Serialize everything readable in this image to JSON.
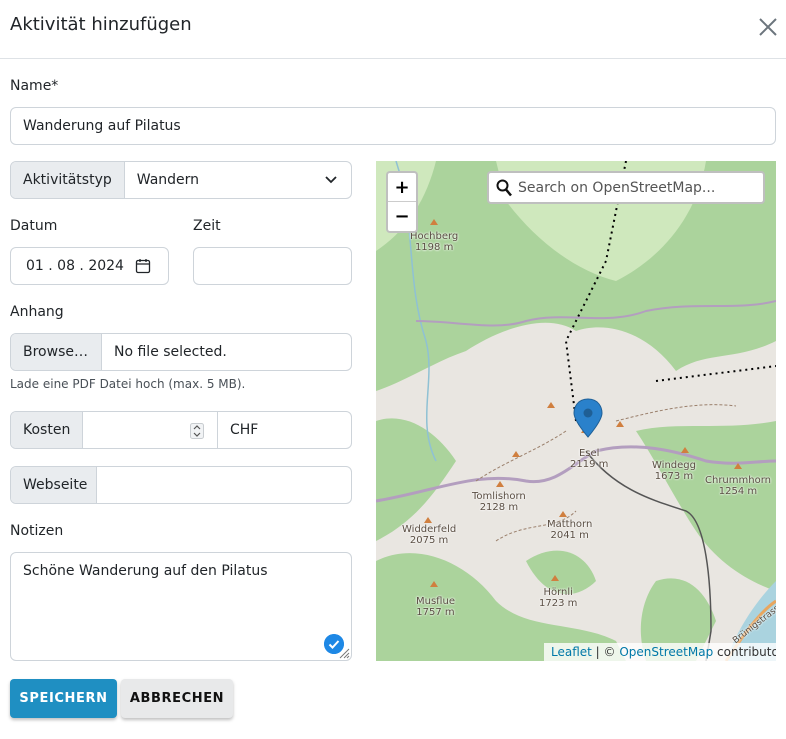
{
  "modal": {
    "title": "Aktivität hinzufügen"
  },
  "form": {
    "name_label": "Name*",
    "name_value": "Wanderung auf Pilatus",
    "type_label": "Aktivitätstyp",
    "type_value": "Wandern",
    "date_label": "Datum",
    "date_value": "01 . 08 . 2024",
    "time_label": "Zeit",
    "time_value": "",
    "attachment_label": "Anhang",
    "browse_label": "Browse…",
    "file_status": "No file selected.",
    "attachment_hint": "Lade eine PDF Datei hoch (max. 5 MB).",
    "cost_label": "Kosten",
    "cost_value": "",
    "currency_value": "CHF",
    "website_label": "Webseite",
    "website_value": "",
    "notes_label": "Notizen",
    "notes_value": "Schöne Wanderung auf den Pilatus"
  },
  "buttons": {
    "save": "SPEICHERN",
    "cancel": "ABBRECHEN"
  },
  "map": {
    "zoom_in": "+",
    "zoom_out": "−",
    "search_placeholder": "Search on OpenStreetMap...",
    "attribution": {
      "leaflet": "Leaflet",
      "separator": " | © ",
      "osm": "OpenStreetMap",
      "suffix": " contributors"
    },
    "places": [
      {
        "name": "Hochberg",
        "elev": "1198 m"
      },
      {
        "name": "Esel",
        "elev": "2119 m"
      },
      {
        "name": "Windegg",
        "elev": "1673 m"
      },
      {
        "name": "Chrummhorn",
        "elev": "1254 m"
      },
      {
        "name": "Tomlishorn",
        "elev": "2128 m"
      },
      {
        "name": "Widderfeld",
        "elev": "2075 m"
      },
      {
        "name": "Matthorn",
        "elev": "2041 m"
      },
      {
        "name": "Hörnli",
        "elev": "1723 m"
      },
      {
        "name": "Musflue",
        "elev": "1757 m"
      }
    ],
    "road_label": "Brünigstrasse",
    "colors": {
      "forest": "#abd39c",
      "rock": "#e9e6e1",
      "water": "#aad3df",
      "marker": "#2a81cb"
    }
  }
}
